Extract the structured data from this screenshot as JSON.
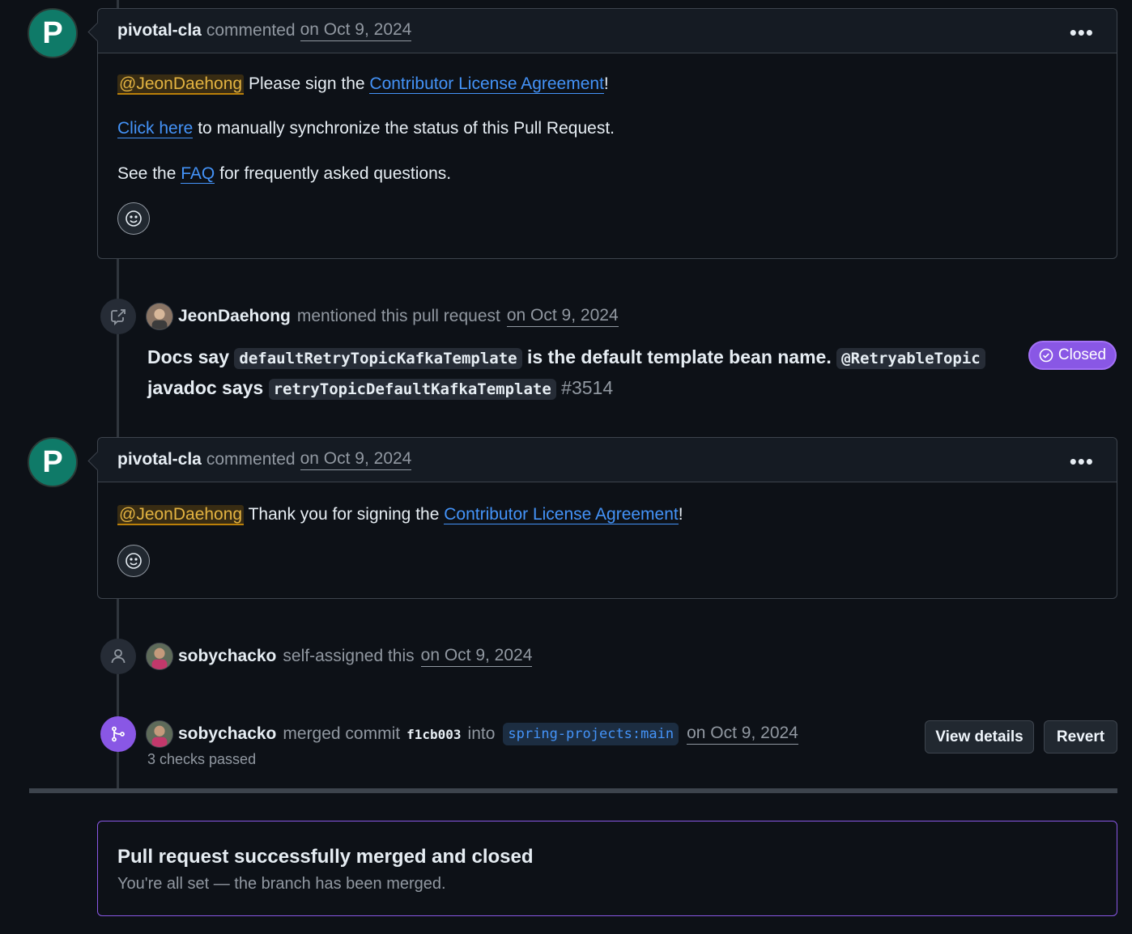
{
  "comment1": {
    "avatar_letter": "P",
    "author": "pivotal-cla",
    "action": "commented",
    "date": "on Oct 9, 2024",
    "mention": "@JeonDaehong",
    "line1_text": "Please sign the",
    "cla_link": "Contributor License Agreement",
    "line1_end": "!",
    "click_here": "Click here",
    "line2_text": "to manually synchronize the status of this Pull Request.",
    "see_the": "See the",
    "faq": "FAQ",
    "line3_text": "for frequently asked questions."
  },
  "mention_event": {
    "author": "JeonDaehong",
    "action": "mentioned this pull request",
    "date": "on Oct 9, 2024",
    "title_part1": "Docs say",
    "code1": "defaultRetryTopicKafkaTemplate",
    "title_part2": "is the default template bean name.",
    "code2": "@RetryableTopic",
    "title_part3": "javadoc says",
    "code3": "retryTopicDefaultKafkaTemplate",
    "issue_number": "#3514",
    "status": "Closed"
  },
  "comment2": {
    "avatar_letter": "P",
    "author": "pivotal-cla",
    "action": "commented",
    "date": "on Oct 9, 2024",
    "mention": "@JeonDaehong",
    "text": "Thank you for signing the",
    "cla_link": "Contributor License Agreement",
    "end": "!"
  },
  "assign_event": {
    "author": "sobychacko",
    "action": "self-assigned this",
    "date": "on Oct 9, 2024"
  },
  "merge_event": {
    "author": "sobychacko",
    "action": "merged commit",
    "sha": "f1cb003",
    "into": "into",
    "branch": "spring-projects:main",
    "date": "on Oct 9, 2024",
    "checks": "3 checks passed",
    "view_details": "View details",
    "revert": "Revert"
  },
  "merged_box": {
    "title": "Pull request successfully merged and closed",
    "subtitle": "You're all set — the branch has been merged."
  }
}
